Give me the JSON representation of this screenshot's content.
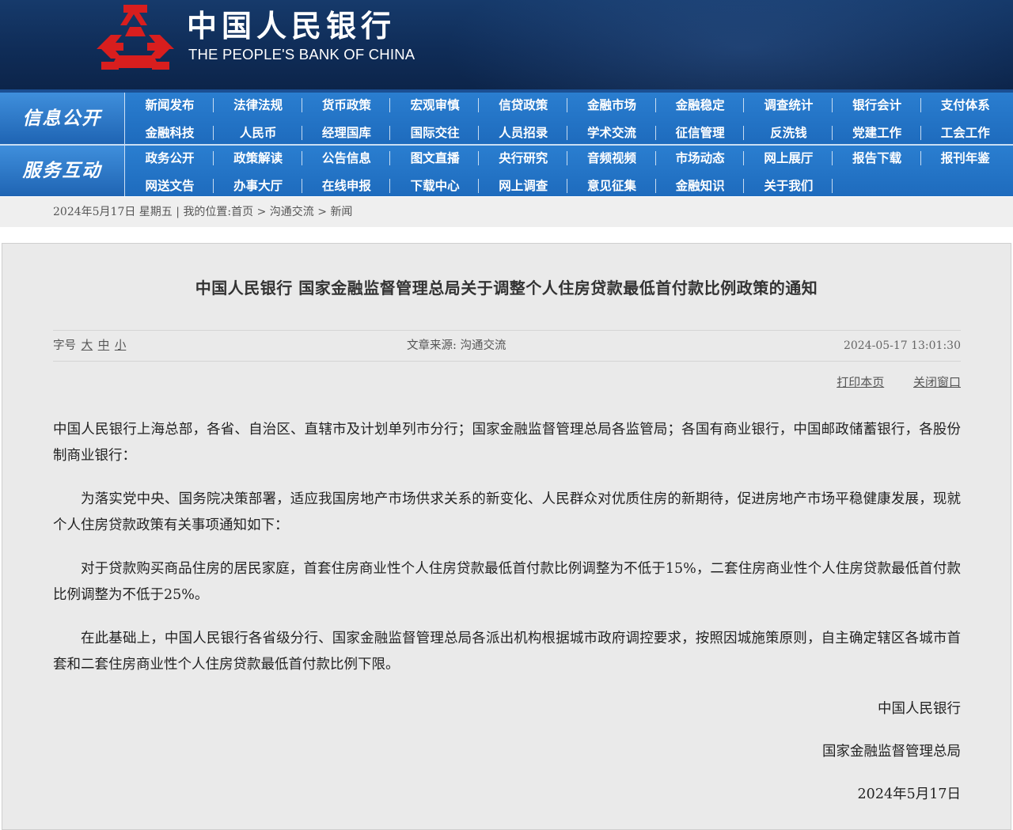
{
  "header": {
    "bank_name_cn": "中国人民银行",
    "bank_name_en": "THE PEOPLE'S BANK OF CHINA",
    "logo_icon": "pboc-emblem-icon",
    "colors": {
      "banner": "#0f2c57",
      "nav": "#1e6bbd",
      "logo_red": "#d81e1e"
    }
  },
  "nav": {
    "section1": {
      "label": "信息公开",
      "rows": [
        [
          "新闻发布",
          "法律法规",
          "货币政策",
          "宏观审慎",
          "信贷政策",
          "金融市场",
          "金融稳定",
          "调查统计",
          "银行会计",
          "支付体系"
        ],
        [
          "金融科技",
          "人民币",
          "经理国库",
          "国际交往",
          "人员招录",
          "学术交流",
          "征信管理",
          "反洗钱",
          "党建工作",
          "工会工作"
        ]
      ]
    },
    "section2": {
      "label": "服务互动",
      "rows": [
        [
          "政务公开",
          "政策解读",
          "公告信息",
          "图文直播",
          "央行研究",
          "音频视频",
          "市场动态",
          "网上展厅",
          "报告下载",
          "报刊年鉴"
        ],
        [
          "网送文告",
          "办事大厅",
          "在线申报",
          "下载中心",
          "网上调查",
          "意见征集",
          "金融知识",
          "关于我们"
        ]
      ]
    }
  },
  "breadcrumb": {
    "date": "2024年5月17日 星期五",
    "sep": "|",
    "prefix": "我的位置:",
    "home": "首页",
    "arrow": ">",
    "level1": "沟通交流",
    "level2": "新闻"
  },
  "article": {
    "title": "中国人民银行 国家金融监督管理总局关于调整个人住房贷款最低首付款比例政策的通知",
    "font_size_label": "字号",
    "size_large": "大",
    "size_medium": "中",
    "size_small": "小",
    "source_label": "文章来源:",
    "source": "沟通交流",
    "datetime": "2024-05-17 13:01:30",
    "print_label": "打印本页",
    "close_label": "关闭窗口",
    "paragraphs": [
      "中国人民银行上海总部，各省、自治区、直辖市及计划单列市分行；国家金融监督管理总局各监管局；各国有商业银行，中国邮政储蓄银行，各股份制商业银行：",
      "为落实党中央、国务院决策部署，适应我国房地产市场供求关系的新变化、人民群众对优质住房的新期待，促进房地产市场平稳健康发展，现就个人住房贷款政策有关事项通知如下：",
      "对于贷款购买商品住房的居民家庭，首套住房商业性个人住房贷款最低首付款比例调整为不低于15%，二套住房商业性个人住房贷款最低首付款比例调整为不低于25%。",
      "在此基础上，中国人民银行各省级分行、国家金融监督管理总局各派出机构根据城市政府调控要求，按照因城施策原则，自主确定辖区各城市首套和二套住房商业性个人住房贷款最低首付款比例下限。"
    ],
    "signatory1": "中国人民银行",
    "signatory2": "国家金融监督管理总局",
    "sign_date": "2024年5月17日"
  }
}
